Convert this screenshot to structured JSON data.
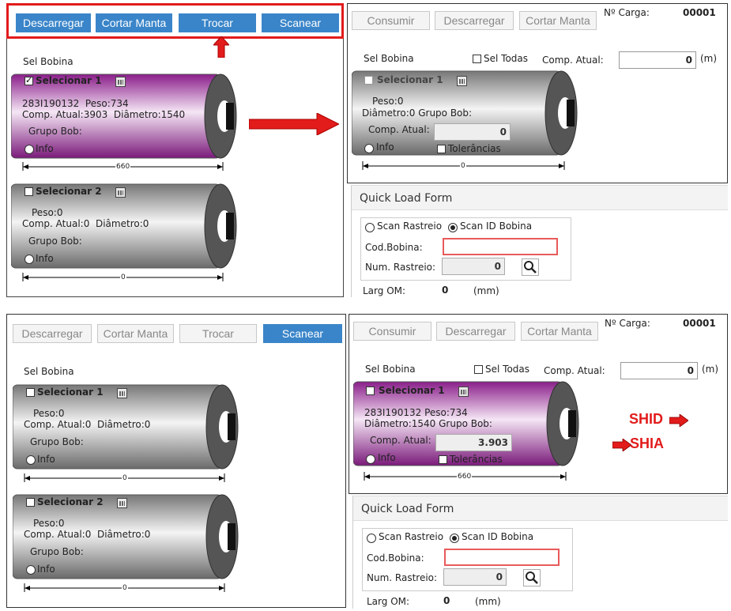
{
  "buttons": {
    "descarregar": "Descarregar",
    "cortar_manta": "Cortar Manta",
    "trocar": "Trocar",
    "scanear": "Scanear",
    "consumir": "Consumir"
  },
  "labels": {
    "sel_bobina": "Sel Bobina",
    "sel_todas": "Sel Todas",
    "comp_atual": "Comp. Atual:",
    "unit_m": "(m)",
    "n_carga": "Nº Carga:",
    "carga": "00001",
    "selecionar_1": "Selecionar 1",
    "selecionar_2": "Selecionar 2",
    "grupo_bob": "Grupo Bob:",
    "info": "Info",
    "tolerancias": "Tolerâncias",
    "comp_atual_short": "Comp. Atual:",
    "quick_load": "Quick Load Form",
    "scan_rastreio": "Scan Rastreio",
    "scan_id": "Scan ID Bobina",
    "cod_bobina": "Cod.Bobina:",
    "num_rastreio": "Num. Rastreio:",
    "larg_om": "Larg OM:",
    "larg_val": "0",
    "mm": "(mm)"
  },
  "bobina_loaded": {
    "codigo": "283I190132",
    "peso": "Peso:734",
    "comp": "Comp. Atual:3903",
    "diam": "Diâmetro:1540",
    "width": "660"
  },
  "bobina_empty": {
    "peso": "Peso:0",
    "comp": "Comp. Atual:0",
    "diam": "Diâmetro:0",
    "diam_grupo": "Diâmetro:0   Grupo Bob:",
    "width": "0"
  },
  "right_loaded": {
    "line2": "Diâmetro:1540   Grupo Bob:",
    "peso": "283I190132    Peso:734"
  },
  "values": {
    "comp_zero": "0",
    "comp_3903": "3.903",
    "num_zero": "0"
  },
  "annotations": {
    "shid": "SHID",
    "shia": "SHIA"
  },
  "colors": {
    "primary": "#3a85c9",
    "highlight": "#e21b1b",
    "bobina_loaded": "#9b2a9b"
  }
}
